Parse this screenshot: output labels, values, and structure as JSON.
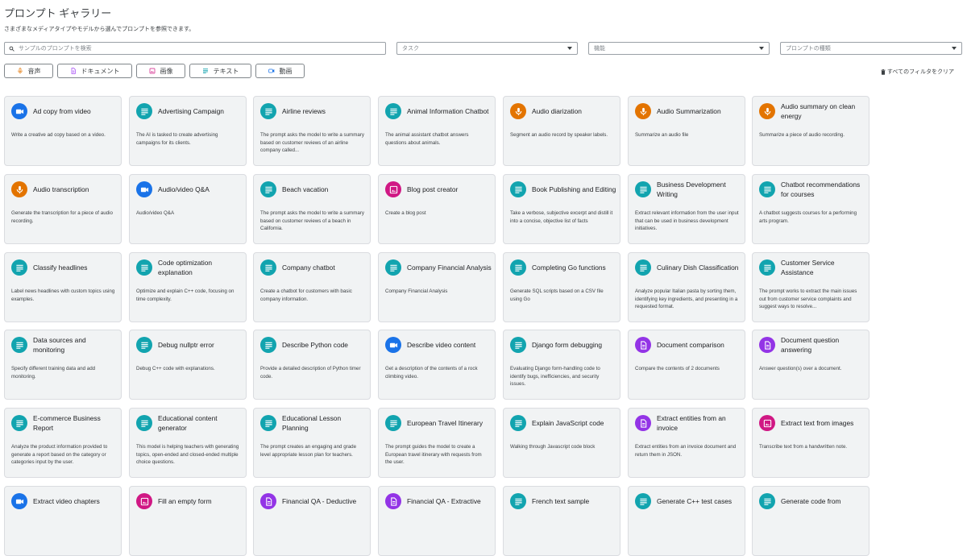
{
  "page": {
    "title": "プロンプト ギャラリー",
    "subtitle": "さまざまなメディアタイプやモデルから選んでプロンプトを参照できます。"
  },
  "filters": {
    "search_placeholder": "サンプルのプロンプトを検索",
    "task_placeholder": "タスク",
    "feature_placeholder": "機能",
    "prompt_type_placeholder": "プロンプトの種類",
    "clear_label": "すべてのフィルタをクリア"
  },
  "chips": [
    {
      "label": "音声",
      "icon": "mic-icon",
      "color": "#e37400"
    },
    {
      "label": "ドキュメント",
      "icon": "document-icon",
      "color": "#a142f4"
    },
    {
      "label": "画像",
      "icon": "image-icon",
      "color": "#d01884"
    },
    {
      "label": "テキスト",
      "icon": "text-icon",
      "color": "#12a4af"
    },
    {
      "label": "動画",
      "icon": "video-icon",
      "color": "#1a73e8"
    }
  ],
  "type_colors": {
    "audio": "#e37400",
    "document": "#9334e6",
    "image": "#d01884",
    "text": "#12a4af",
    "video": "#1a73e8"
  },
  "cards": [
    {
      "title": "Ad copy from video",
      "desc": "Write a creative ad copy based on a video.",
      "type": "video"
    },
    {
      "title": "Advertising Campaign",
      "desc": "The AI is tasked to create advertising campaigns for its clients.",
      "type": "text"
    },
    {
      "title": "Airline reviews",
      "desc": "The prompt asks the model to write a summary based on customer reviews of an airline company called...",
      "type": "text"
    },
    {
      "title": "Animal Information Chatbot",
      "desc": "The animal assistant chatbot answers questions about animals.",
      "type": "text"
    },
    {
      "title": "Audio diarization",
      "desc": "Segment an audio record by speaker labels.",
      "type": "audio"
    },
    {
      "title": "Audio Summarization",
      "desc": "Summarize an audio file",
      "type": "audio"
    },
    {
      "title": "Audio summary on clean energy",
      "desc": "Summarize a piece of audio recording.",
      "type": "audio"
    },
    {
      "title": "Audio transcription",
      "desc": "Generate the transcription for a piece of audio recording.",
      "type": "audio"
    },
    {
      "title": "Audio/video Q&A",
      "desc": "Audio/video Q&A",
      "type": "video"
    },
    {
      "title": "Beach vacation",
      "desc": "The prompt asks the model to write a summary based on customer reviews of a beach in California.",
      "type": "text"
    },
    {
      "title": "Blog post creator",
      "desc": "Create a blog post",
      "type": "image"
    },
    {
      "title": "Book Publishing and Editing",
      "desc": "Take a verbose, subjective excerpt and distill it into a concise, objective list of facts",
      "type": "text"
    },
    {
      "title": "Business Development Writing",
      "desc": "Extract relevant information from the user input that can be used in business development initiatives.",
      "type": "text"
    },
    {
      "title": "Chatbot recommendations for courses",
      "desc": "A chatbot suggests courses for a performing arts program.",
      "type": "text"
    },
    {
      "title": "Classify headlines",
      "desc": "Label news headlines with custom topics using examples.",
      "type": "text"
    },
    {
      "title": "Code optimization explanation",
      "desc": "Optimize and explain C++ code, focusing on time complexity.",
      "type": "text"
    },
    {
      "title": "Company chatbot",
      "desc": "Create a chatbot for customers with basic company information.",
      "type": "text"
    },
    {
      "title": "Company Financial Analysis",
      "desc": "Company Financial Analysis",
      "type": "text"
    },
    {
      "title": "Completing Go functions",
      "desc": "Generate SQL scripts based on a CSV file using Go",
      "type": "text"
    },
    {
      "title": "Culinary Dish Classification",
      "desc": "Analyze popular Italian pasta by sorting them, identifying key ingredients, and presenting in a requested format.",
      "type": "text"
    },
    {
      "title": "Customer Service Assistance",
      "desc": "The prompt works to extract the main issues out from customer service complaints and suggest ways to resolve...",
      "type": "text"
    },
    {
      "title": "Data sources and monitoring",
      "desc": "Specify different training data and add monitoring.",
      "type": "text"
    },
    {
      "title": "Debug nullptr error",
      "desc": "Debug C++ code with explanations.",
      "type": "text"
    },
    {
      "title": "Describe Python code",
      "desc": "Provide a detailed description of Python timer code.",
      "type": "text"
    },
    {
      "title": "Describe video content",
      "desc": "Get a description of the contents of a rock climbing video.",
      "type": "video"
    },
    {
      "title": "Django form debugging",
      "desc": "Evaluating Django form-handling code to identify bugs, inefficiencies, and security issues.",
      "type": "text"
    },
    {
      "title": "Document comparison",
      "desc": "Compare the contents of 2 documents",
      "type": "document"
    },
    {
      "title": "Document question answering",
      "desc": "Answer question(s) over a document.",
      "type": "document"
    },
    {
      "title": "E-commerce Business Report",
      "desc": "Analyze the product information provided to generate a report based on the category or categories input by the user.",
      "type": "text"
    },
    {
      "title": "Educational content generator",
      "desc": "This model is helping teachers with generating topics, open-ended and closed-ended multiple choice questions.",
      "type": "text"
    },
    {
      "title": "Educational Lesson Planning",
      "desc": "The prompt creates an engaging and grade level appropriate lesson plan for teachers.",
      "type": "text"
    },
    {
      "title": "European Travel Itinerary",
      "desc": "The prompt guides the model to create a European travel itinerary with requests from the user.",
      "type": "text"
    },
    {
      "title": "Explain JavaScript code",
      "desc": "Walking through Javascript code block",
      "type": "text"
    },
    {
      "title": "Extract entities from an invoice",
      "desc": "Extract entities from an invoice document and return them in JSON.",
      "type": "document"
    },
    {
      "title": "Extract text from images",
      "desc": "Transcribe text from a handwritten note.",
      "type": "image"
    },
    {
      "title": "Extract video chapters",
      "desc": "",
      "type": "video"
    },
    {
      "title": "Fill an empty form",
      "desc": "",
      "type": "image"
    },
    {
      "title": "Financial QA - Deductive",
      "desc": "",
      "type": "document"
    },
    {
      "title": "Financial QA - Extractive",
      "desc": "",
      "type": "document"
    },
    {
      "title": "French text sample",
      "desc": "",
      "type": "text"
    },
    {
      "title": "Generate C++ test cases",
      "desc": "",
      "type": "text"
    },
    {
      "title": "Generate code from",
      "desc": "",
      "type": "text"
    }
  ]
}
